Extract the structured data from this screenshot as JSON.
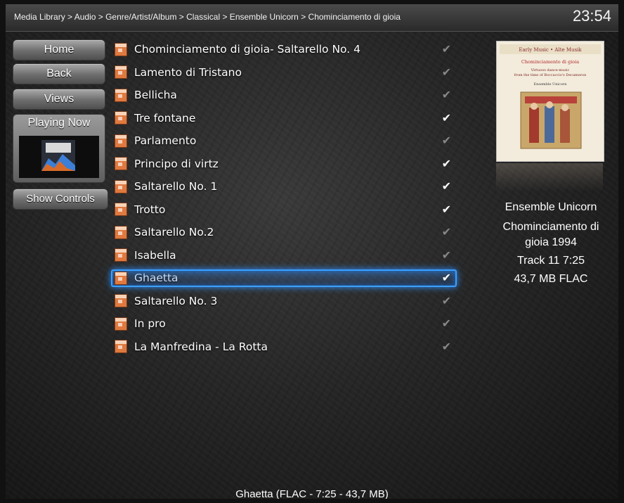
{
  "header": {
    "breadcrumb": "Media Library > Audio > Genre/Artist/Album > Classical > Ensemble Unicorn > Chominciamento di gioia",
    "clock": "23:54"
  },
  "nav": {
    "home": "Home",
    "back": "Back",
    "views": "Views",
    "playing_now": "Playing Now",
    "show_controls": "Show Controls"
  },
  "tracks": [
    {
      "title": "Chominciamento di gioia- Saltarello No. 4",
      "checked": "dim"
    },
    {
      "title": "Lamento di Tristano",
      "checked": "dim"
    },
    {
      "title": "Bellicha",
      "checked": "dim"
    },
    {
      "title": "Tre fontane",
      "checked": "on"
    },
    {
      "title": "Parlamento",
      "checked": "dim"
    },
    {
      "title": "Principo di virtz",
      "checked": "on"
    },
    {
      "title": "Saltarello No. 1",
      "checked": "on"
    },
    {
      "title": "Trotto",
      "checked": "on"
    },
    {
      "title": "Saltarello No.2",
      "checked": "dim"
    },
    {
      "title": "Isabella",
      "checked": "dim"
    },
    {
      "title": "Ghaetta",
      "checked": "on",
      "selected": true
    },
    {
      "title": "Saltarello No. 3",
      "checked": "dim"
    },
    {
      "title": "In pro",
      "checked": "dim"
    },
    {
      "title": "La Manfredina - La Rotta",
      "checked": "dim"
    }
  ],
  "cover": {
    "banner": "Early Music • Alte Musik",
    "title": "Chominciamento di gioia",
    "subtitle1": "Virtuoso dance-music",
    "subtitle2": "from the time of Boccaccio's Decameron",
    "artist": "Ensemble Unicorn"
  },
  "info": {
    "artist": "Ensemble Unicorn",
    "album": "Chominciamento di",
    "album_year": "gioia   1994",
    "track": "Track 11   7:25",
    "size_format": "43,7 MB   FLAC"
  },
  "status": "Ghaetta (FLAC - 7:25 - 43,7 MB)",
  "colors": {
    "selection": "#3ba0ff",
    "file_icon": "#e0793f"
  }
}
